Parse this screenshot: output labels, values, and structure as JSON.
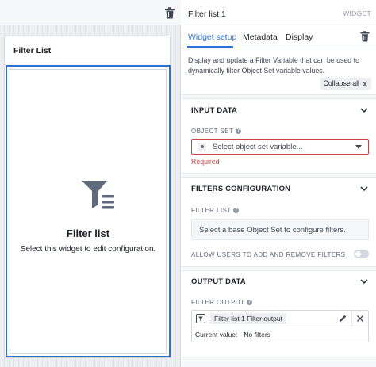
{
  "canvas": {
    "widget_title": "Filter List",
    "empty_state": {
      "title": "Filter list",
      "subtitle": "Select this widget to edit configuration.",
      "icon": "filter-list-icon"
    },
    "toolbar_icon": "trash-icon"
  },
  "panel": {
    "title": "Filter list 1",
    "kind": "WIDGET",
    "tabs": [
      {
        "label": "Widget setup",
        "active": true
      },
      {
        "label": "Metadata",
        "active": false
      },
      {
        "label": "Display",
        "active": false
      }
    ],
    "description": "Display and update a Filter Variable that can be used to dynamically filter Object Set variable values.",
    "collapse_all": "Collapse all",
    "sections": {
      "input": {
        "title": "INPUT DATA",
        "object_set_label": "OBJECT SET",
        "object_set_placeholder": "Select object set variable...",
        "error": "Required"
      },
      "filters": {
        "title": "FILTERS CONFIGURATION",
        "filter_list_label": "FILTER LIST",
        "filter_list_hint": "Select a base Object Set to configure filters.",
        "toggle_label": "ALLOW USERS TO ADD AND REMOVE FILTERS",
        "toggle_on": false
      },
      "output": {
        "title": "OUTPUT DATA",
        "filter_output_label": "FILTER OUTPUT",
        "output_name": "Filter list 1 Filter output",
        "current_value_label": "Current value:",
        "current_value": "No filters"
      }
    }
  },
  "colors": {
    "accent": "#2d72d2",
    "error": "#cd4246",
    "text": "#1c2127",
    "muted": "#5f6b7c"
  }
}
